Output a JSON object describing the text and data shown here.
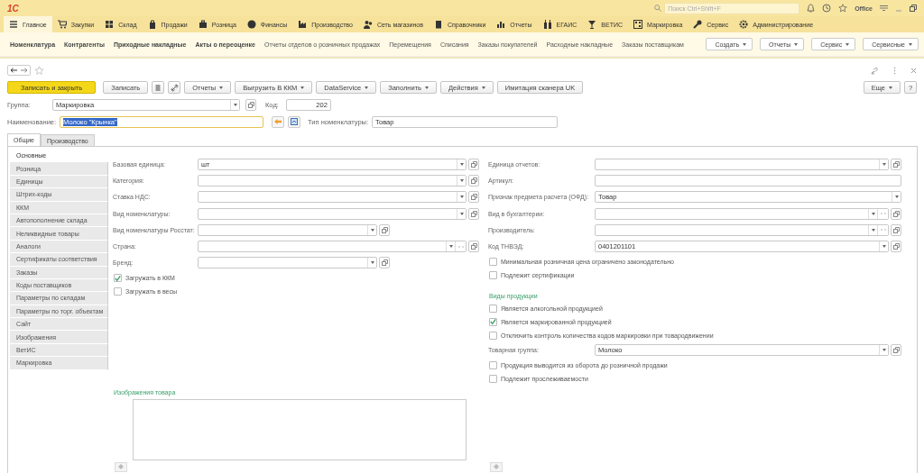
{
  "top_bar": {
    "logo": "1С",
    "search": {
      "placeholder": "Поиск Ctrl+Shift+F"
    },
    "user": "Office"
  },
  "sections": [
    {
      "label": "Главное",
      "selected": true
    },
    {
      "label": "Закупки",
      "selected": false
    },
    {
      "label": "Склад",
      "selected": false
    },
    {
      "label": "Продажи",
      "selected": false
    },
    {
      "label": "Розница",
      "selected": false
    },
    {
      "label": "Финансы",
      "selected": false
    },
    {
      "label": "Производство",
      "selected": false
    },
    {
      "label": "Сеть магазинов",
      "selected": false
    },
    {
      "label": "Справочники",
      "selected": false
    },
    {
      "label": "Отчеты",
      "selected": false
    },
    {
      "label": "ЕГАИС",
      "selected": false
    },
    {
      "label": "ВЕТИС",
      "selected": false
    },
    {
      "label": "Маркировка",
      "selected": false
    },
    {
      "label": "Сервис",
      "selected": false
    },
    {
      "label": "Администрирование",
      "selected": false
    }
  ],
  "nav_links": [
    {
      "label": "Номенклатура",
      "important": true
    },
    {
      "label": "Контрагенты",
      "important": true
    },
    {
      "label": "Приходные накладные",
      "important": true
    },
    {
      "label": "Акты о переоценке",
      "important": true
    },
    {
      "label": "Отчеты отделов о розничных продажах",
      "important": false
    },
    {
      "label": "Перемещения",
      "important": false
    },
    {
      "label": "Списания",
      "important": false
    },
    {
      "label": "Заказы покупателей",
      "important": false
    },
    {
      "label": "Расходные накладные",
      "important": false
    },
    {
      "label": "Заказы поставщикам",
      "important": false
    }
  ],
  "nav_buttons": [
    "Создать",
    "Отчеты",
    "Сервис",
    "Сервисные"
  ],
  "toolbar": [
    {
      "kind": "primary",
      "label": "Записать и закрыть"
    },
    {
      "kind": "plain",
      "label": "Записать"
    },
    {
      "kind": "delete"
    },
    {
      "kind": "attach"
    },
    {
      "kind": "menu",
      "label": "Отчеты"
    },
    {
      "kind": "menu",
      "label": "Выгрузить В ККМ"
    },
    {
      "kind": "menu",
      "label": "DataService"
    },
    {
      "kind": "menu",
      "label": "Заполнить"
    },
    {
      "kind": "menu",
      "label": "Действия"
    },
    {
      "kind": "plain",
      "label": "Имитация сканера UK"
    }
  ],
  "toolbar_right": {
    "more": "Еще",
    "help": "?"
  },
  "header": {
    "group": {
      "label": "Группа:",
      "value": "Маркировка"
    },
    "code": {
      "label": "Код:",
      "value": "202"
    },
    "name": {
      "label": "Наименование:",
      "value": "Молоко \"Крынка\"",
      "text_selected": true
    },
    "type": {
      "label": "Тип номенклатуры:",
      "value": "Товар"
    }
  },
  "tabs": [
    {
      "label": "Общие",
      "selected": true
    },
    {
      "label": "Производство",
      "selected": false
    }
  ],
  "side_items": [
    {
      "label": "Основные",
      "selected": true
    },
    {
      "label": "Розница",
      "selected": false
    },
    {
      "label": "Единицы",
      "selected": false
    },
    {
      "label": "Штрих-коды",
      "selected": false
    },
    {
      "label": "ККМ",
      "selected": false
    },
    {
      "label": "Автопополнение склада",
      "selected": false
    },
    {
      "label": "Неликвидные товары",
      "selected": false
    },
    {
      "label": "Аналоги",
      "selected": false
    },
    {
      "label": "Сертификаты соответствия",
      "selected": false
    },
    {
      "label": "Заказы",
      "selected": false
    },
    {
      "label": "Коды поставщиков",
      "selected": false
    },
    {
      "label": "Параметры по складам",
      "selected": false
    },
    {
      "label": "Параметры по торг. объектам",
      "selected": false
    },
    {
      "label": "Сайт",
      "selected": false
    },
    {
      "label": "Изображения",
      "selected": false
    },
    {
      "label": "ВетИС",
      "selected": false
    },
    {
      "label": "Маркировка",
      "selected": false
    }
  ],
  "left_column": [
    {
      "kind": "select",
      "label": "Базовая единица:",
      "value": "шт"
    },
    {
      "kind": "select",
      "label": "Категория:"
    },
    {
      "kind": "select",
      "label": "Ставка НДС:"
    },
    {
      "kind": "select",
      "label": "Вид номенклатуры:"
    },
    {
      "kind": "short",
      "label": "Вид номенклатуры Росстат:"
    },
    {
      "kind": "chooser",
      "label": "Страна:"
    },
    {
      "kind": "short",
      "label": "Бренд:"
    },
    {
      "kind": "check",
      "label": "Загружать в ККМ",
      "checked": true
    },
    {
      "kind": "check",
      "label": "Загружать в весы",
      "checked": false
    }
  ],
  "right_column": [
    {
      "kind": "select",
      "label": "Единица отчетов:"
    },
    {
      "kind": "text",
      "label": "Артикул:"
    },
    {
      "kind": "dropdown",
      "label": "Признак предмета расчета (ОФД):",
      "value": "Товар"
    },
    {
      "kind": "chooser",
      "label": "Вид в бухгалтерии:"
    },
    {
      "kind": "chooser",
      "label": "Производитель:"
    },
    {
      "kind": "select",
      "label": "Код ТНВЭД:",
      "value": "0401201101"
    },
    {
      "kind": "check",
      "label": "Минимальная розничная цена ограничено законодательно",
      "checked": false
    },
    {
      "kind": "check",
      "label": "Подлежит сертификации",
      "checked": false
    },
    {
      "kind": "heading",
      "label": "Виды продукции"
    },
    {
      "kind": "check",
      "label": "Является алкогольной продукцией",
      "checked": false
    },
    {
      "kind": "check",
      "label": "Является маркированной продукцией",
      "checked": true
    },
    {
      "kind": "check",
      "label": "Отключить контроль количества кодов маркировки при товародвижении",
      "checked": false
    },
    {
      "kind": "select",
      "label": "Товарная группа:",
      "value": "Молоко"
    },
    {
      "kind": "check",
      "label": "Продукция выводится из оборота до розничной продажи",
      "checked": false
    },
    {
      "kind": "check",
      "label": "Подлежит прослеживаемости",
      "checked": false
    }
  ],
  "image_section": {
    "title": "Изображения товара"
  }
}
